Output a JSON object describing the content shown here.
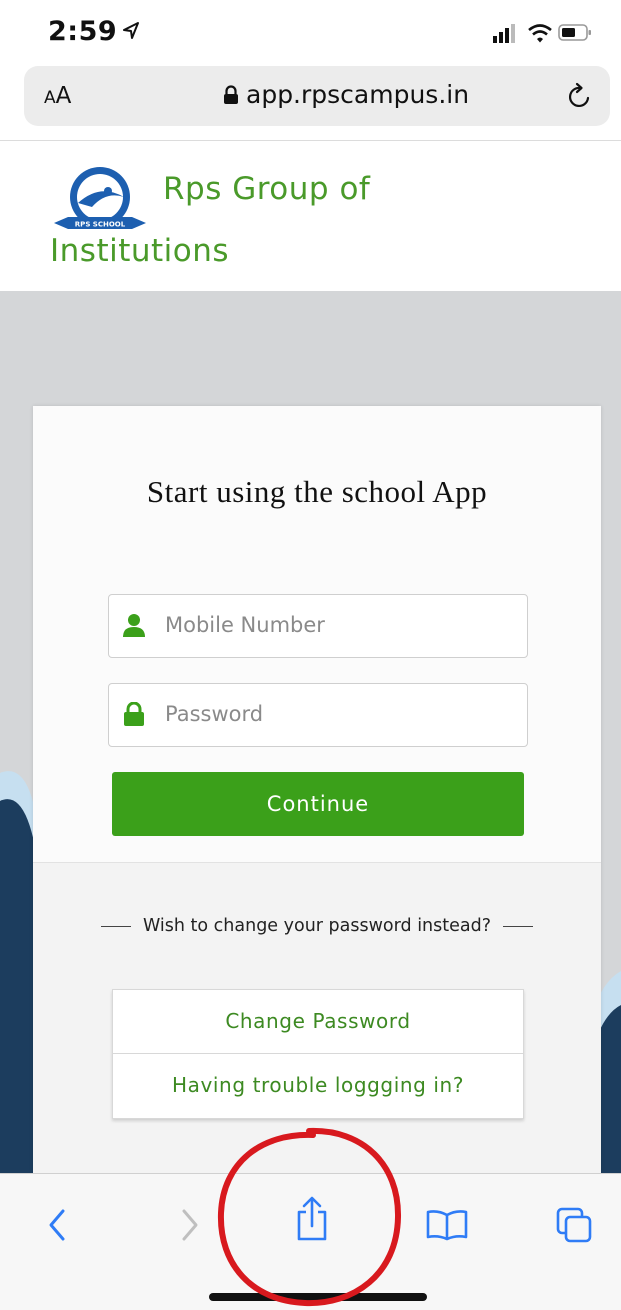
{
  "status_bar": {
    "time": "2:59",
    "icons": [
      "location-arrow-icon",
      "cellular-signal-icon",
      "wifi-icon",
      "battery-icon"
    ]
  },
  "browser": {
    "text_size_label_small": "A",
    "text_size_label_big": "A",
    "url": "app.rpscampus.in",
    "icons": [
      "lock-icon",
      "reload-icon"
    ]
  },
  "header": {
    "logo_text": "RPS SCHOOL",
    "brand_line1": "Rps Group of",
    "brand_line2": "Institutions"
  },
  "login": {
    "title": "Start using the school App",
    "mobile_placeholder": "Mobile Number",
    "password_placeholder": "Password",
    "continue_label": "Continue",
    "change_prompt": "Wish to change your password instead?",
    "change_password_label": "Change Password",
    "trouble_label": "Having trouble loggging in?"
  },
  "toolbar": {
    "icons": [
      "back-icon",
      "forward-icon",
      "share-icon",
      "bookmarks-icon",
      "tabs-icon"
    ]
  },
  "colors": {
    "brand_green": "#4a9a2a",
    "button_green": "#3ba01a",
    "annotation_red": "#d8191e",
    "page_gray": "#d4d6d8",
    "wave_navy": "#1c3d5e"
  }
}
